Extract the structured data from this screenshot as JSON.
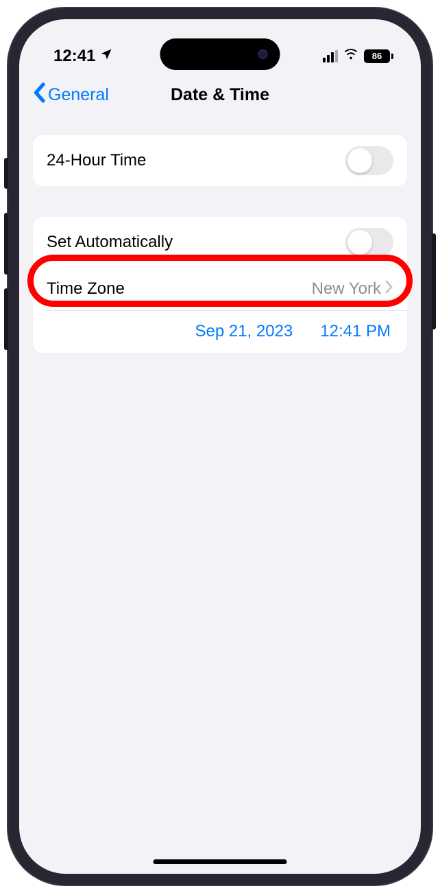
{
  "status": {
    "time": "12:41",
    "battery": "86"
  },
  "nav": {
    "back_label": "General",
    "title": "Date & Time"
  },
  "settings": {
    "twentyfour_hour_label": "24-Hour Time",
    "set_auto_label": "Set Automatically",
    "timezone_label": "Time Zone",
    "timezone_value": "New York",
    "date_value": "Sep 21, 2023",
    "time_value": "12:41 PM"
  }
}
